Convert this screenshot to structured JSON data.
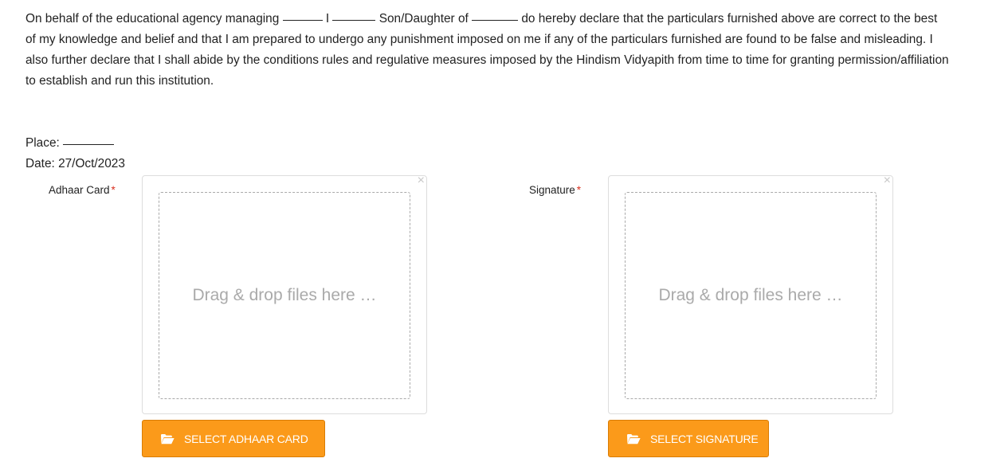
{
  "declaration": {
    "part1": "On behalf of the educational agency managing ",
    "part2": " I ",
    "part3": " Son/Daughter of ",
    "part4": " do hereby declare that the particulars furnished above are correct to the best of my knowledge and belief and that I am prepared to undergo any punishment imposed on me if any of the particulars furnished are found to be false and misleading. I also further declare that I shall abide by the conditions rules and regulative measures imposed by the Hindism Vidyapith from time to time for granting permission/affiliation to establish and run this institution."
  },
  "place": {
    "label": "Place: "
  },
  "date": {
    "label": "Date: ",
    "value": "27/Oct/2023"
  },
  "uploads": {
    "required_marker": "*",
    "close_glyph": "×",
    "adhaar": {
      "label": "Adhaar Card",
      "drop_text": "Drag & drop files here …",
      "button_label": "Select Adhaar Card"
    },
    "signature": {
      "label": "Signature",
      "drop_text": "Drag & drop files here …",
      "button_label": "Select Signature"
    }
  },
  "icons": {
    "close": "close-icon",
    "folder": "folder-open-icon"
  },
  "colors": {
    "accent": "#fb9a1a",
    "required": "#d9301f",
    "placeholder_text": "#aaaaaa"
  }
}
